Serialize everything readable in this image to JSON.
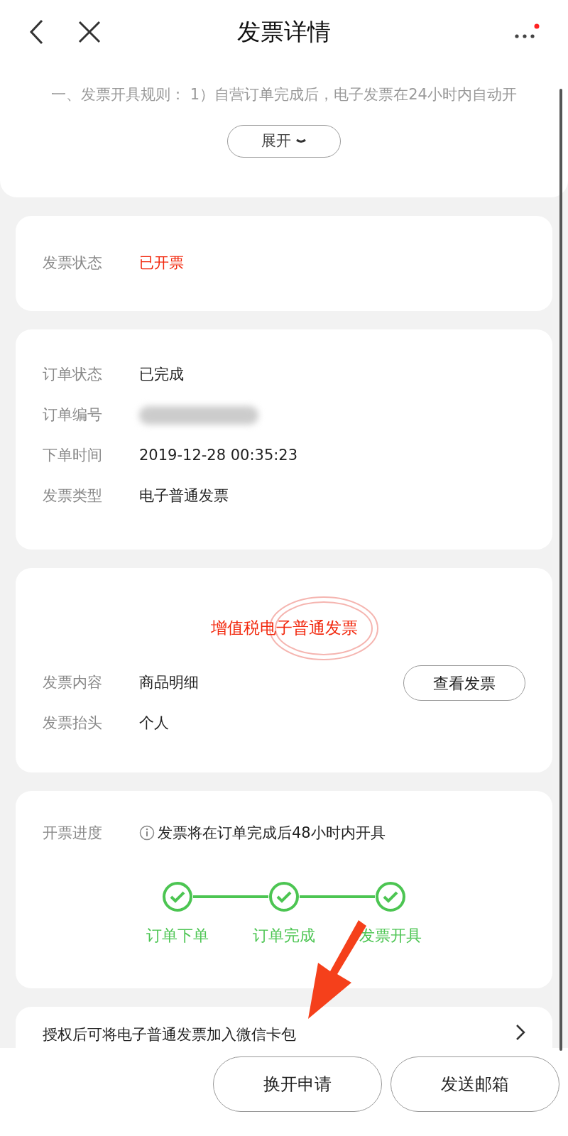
{
  "header": {
    "title": "发票详情",
    "has_notice": true
  },
  "rules": {
    "text": "一、发票开具规则： 1）自营订单完成后，电子发票在24小时内自动开",
    "toggle": "展开"
  },
  "status": {
    "label": "发票状态",
    "value": "已开票"
  },
  "order": [
    {
      "label": "订单状态",
      "value": "已完成",
      "kind": "text"
    },
    {
      "label": "订单编号",
      "kind": "blurred"
    },
    {
      "label": "下单时间",
      "value": "2019-12-28 00:35:23",
      "kind": "text"
    },
    {
      "label": "发票类型",
      "value": "电子普通发票",
      "kind": "text"
    }
  ],
  "invoice": {
    "stamp": "增值税电子普通发票",
    "rows": [
      {
        "label": "发票内容",
        "value": "商品明细"
      },
      {
        "label": "发票抬头",
        "value": "个人"
      }
    ],
    "view_button": "查看发票"
  },
  "progress": {
    "label": "开票进度",
    "note": "发票将在订单完成后48小时内开具",
    "steps": [
      {
        "label": "订单下单",
        "done": true
      },
      {
        "label": "订单完成",
        "done": true
      },
      {
        "label": "发票开具",
        "done": true
      }
    ]
  },
  "wallet": {
    "text": "授权后可将电子普通发票加入微信卡包"
  },
  "buttons": [
    "换开申请",
    "发送邮箱"
  ]
}
